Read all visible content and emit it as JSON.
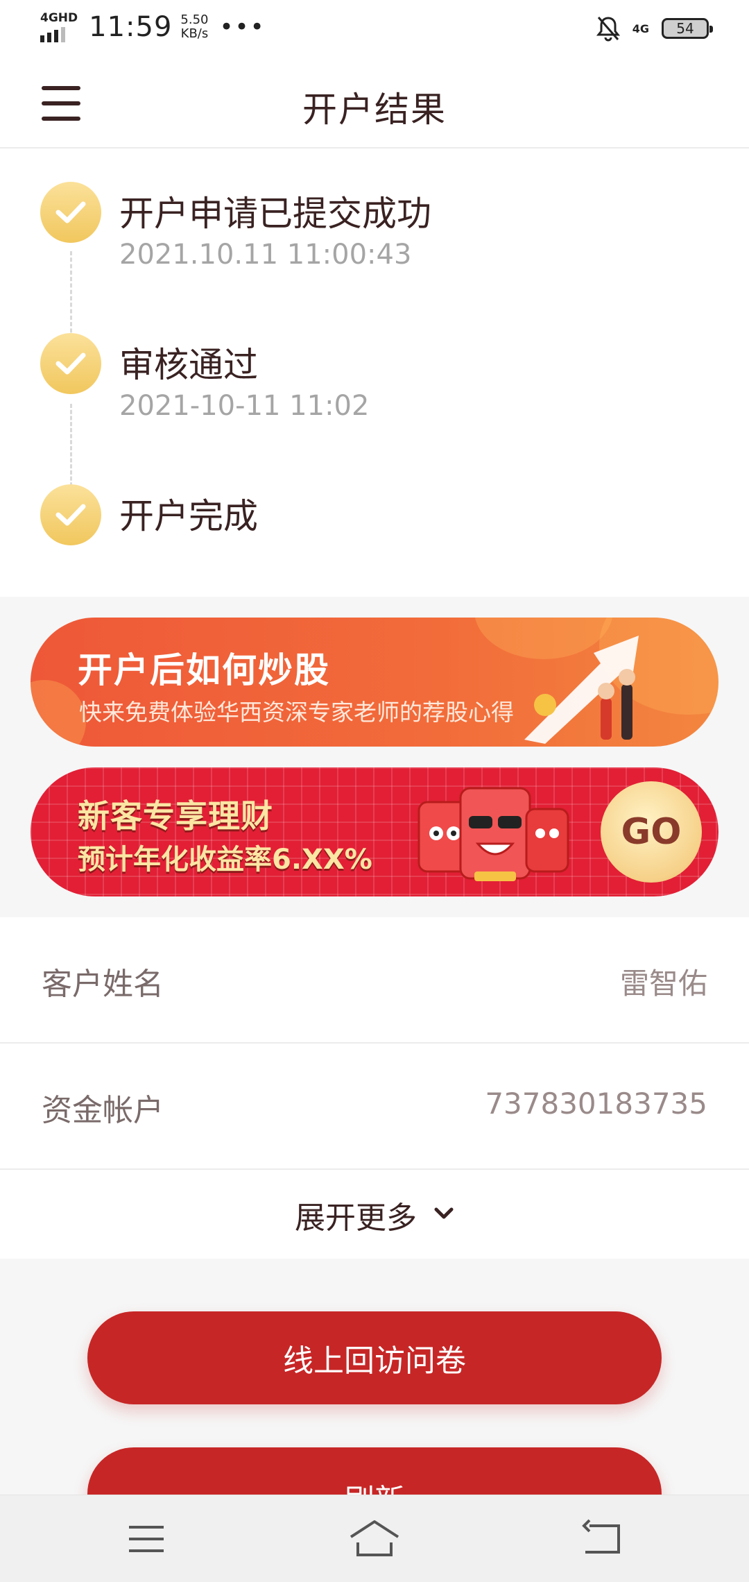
{
  "status_bar": {
    "network": "4GHD",
    "time": "11:59",
    "speed_value": "5.50",
    "speed_unit": "KB/s",
    "more": "•••",
    "network_right": "4G",
    "battery": "54"
  },
  "header": {
    "title": "开户结果"
  },
  "timeline": [
    {
      "title": "开户申请已提交成功",
      "time": "2021.10.11 11:00:43"
    },
    {
      "title": "审核通过",
      "time": "2021-10-11 11:02"
    },
    {
      "title": "开户完成",
      "time": ""
    }
  ],
  "banners": {
    "stock": {
      "title": "开户后如何炒股",
      "subtitle": "快来免费体验华西资深专家老师的荐股心得"
    },
    "finance": {
      "title": "新客专享理财",
      "subtitle": "预计年化收益率6.XX%",
      "go_label": "GO"
    }
  },
  "info": {
    "name_label": "客户姓名",
    "name_value": "雷智佑",
    "account_label": "资金帐户",
    "account_value": "737830183735",
    "expand_label": "展开更多"
  },
  "actions": {
    "survey_label": "线上回访问卷",
    "refresh_label": "刷新"
  },
  "colors": {
    "primary": "#c72626",
    "check_gold": "#f1c75e",
    "banner_orange": "#ee5838",
    "banner_red": "#e21f35"
  }
}
